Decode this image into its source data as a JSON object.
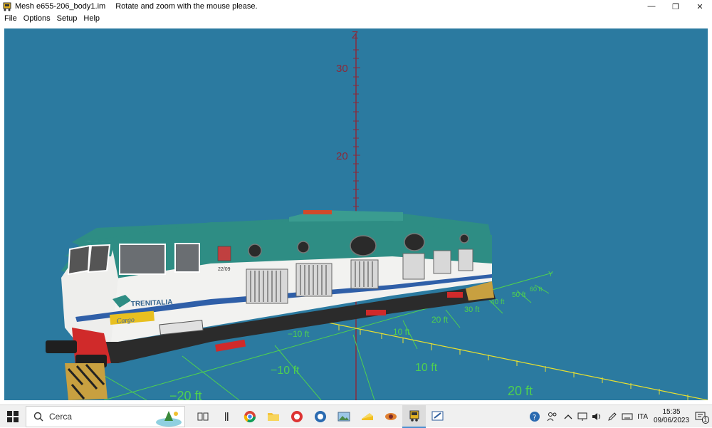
{
  "window": {
    "title": "Mesh e655-206_body1.im",
    "hint": "Rotate and zoom with the mouse please.",
    "minimize_glyph": "—",
    "restore_glyph": "❐",
    "close_glyph": "✕"
  },
  "menu": [
    "File",
    "Options",
    "Setup",
    "Help"
  ],
  "viewport": {
    "background": "#2b7aa0",
    "z_axis_label": "Z",
    "y_axis_label": "Y",
    "z_ticks": [
      "30",
      "20"
    ],
    "grid_labels": {
      "neg10_near": "−10 ft",
      "neg10_far": "−10 ft",
      "pos10_near": "10 ft",
      "pos10_far": "10 ft",
      "pos20_near": "20 ft",
      "pos20_far": "20 ft",
      "neg20": "−20 ft",
      "y30": "30 ft",
      "y40": "40 ft",
      "y50": "50 ft",
      "y60": "60 ft"
    },
    "locomotive": {
      "brand": "TRENITALIA",
      "tagline": "Cargo",
      "number": "22/09",
      "body_color": "#2e8d84",
      "side_color": "#f2f2f0",
      "stripe_color": "#2f5fa8"
    }
  },
  "taskbar": {
    "search_placeholder": "Cerca",
    "language": "ITA",
    "time": "15:35",
    "date": "09/06/2023",
    "notification_count": "1"
  }
}
